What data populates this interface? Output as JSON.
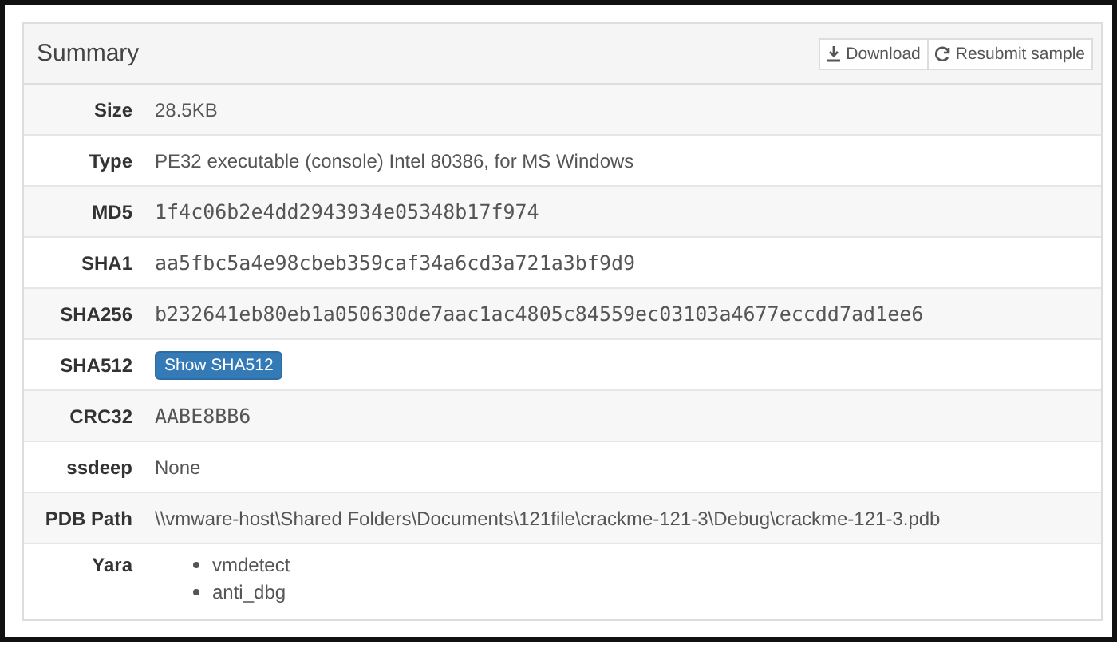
{
  "panel": {
    "title": "Summary",
    "actions": [
      {
        "kind": "download",
        "label": "Download"
      },
      {
        "kind": "resubmit",
        "label": "Resubmit sample"
      }
    ]
  },
  "rows": [
    {
      "label": "Size",
      "kind": "text",
      "value": "28.5KB"
    },
    {
      "label": "Type",
      "kind": "text",
      "value": "PE32 executable (console) Intel 80386, for MS Windows"
    },
    {
      "label": "MD5",
      "kind": "mono",
      "value": "1f4c06b2e4dd2943934e05348b17f974"
    },
    {
      "label": "SHA1",
      "kind": "mono",
      "value": "aa5fbc5a4e98cbeb359caf34a6cd3a721a3bf9d9"
    },
    {
      "label": "SHA256",
      "kind": "mono",
      "value": "b232641eb80eb1a050630de7aac1ac4805c84559ec03103a4677eccdd7ad1ee6"
    },
    {
      "label": "SHA512",
      "kind": "button",
      "value": "Show SHA512"
    },
    {
      "label": "CRC32",
      "kind": "mono",
      "value": "AABE8BB6"
    },
    {
      "label": "ssdeep",
      "kind": "text",
      "value": "None"
    },
    {
      "label": "PDB Path",
      "kind": "text",
      "value": "\\\\vmware-host\\Shared Folders\\Documents\\121file\\crackme-121-3\\Debug\\crackme-121-3.pdb"
    },
    {
      "label": "Yara",
      "kind": "list",
      "items": [
        "vmdetect",
        "anti_dbg"
      ]
    }
  ]
}
